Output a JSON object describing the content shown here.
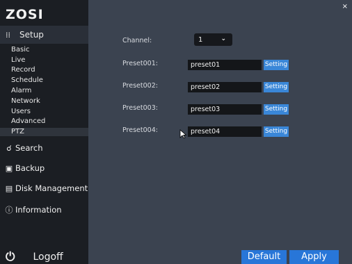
{
  "brand": {
    "logo_text": "ZOSI"
  },
  "sidebar": {
    "setup": {
      "icon": "sliders-icon",
      "label": "Setup"
    },
    "sub_items": [
      "Basic",
      "Live",
      "Record",
      "Schedule",
      "Alarm",
      "Network",
      "Users",
      "Advanced",
      "PTZ"
    ],
    "selected_sub_item": "PTZ",
    "nav": [
      {
        "icon": "search-icon",
        "label": "Search"
      },
      {
        "icon": "backup-icon",
        "label": "Backup"
      },
      {
        "icon": "disk-icon",
        "label": "Disk Management"
      },
      {
        "icon": "info-icon",
        "label": "Information"
      }
    ],
    "logoff": {
      "icon": "power-icon",
      "label": "Logoff"
    }
  },
  "main": {
    "close_glyph": "×",
    "channel": {
      "label": "Channel:",
      "value": "1"
    },
    "presets": [
      {
        "label": "Preset001:",
        "value": "preset01",
        "button": "Setting"
      },
      {
        "label": "Preset002:",
        "value": "preset02",
        "button": "Setting"
      },
      {
        "label": "Preset003:",
        "value": "preset03",
        "button": "Setting"
      },
      {
        "label": "Preset004:",
        "value": "preset04",
        "button": "Setting"
      }
    ],
    "default_button": "Default",
    "apply_button": "Apply"
  },
  "colors": {
    "sidebar_bg": "#1b1e23",
    "panel_bg": "#3b4350",
    "accent": "#2876d8",
    "setting_button": "#3a87d8"
  }
}
